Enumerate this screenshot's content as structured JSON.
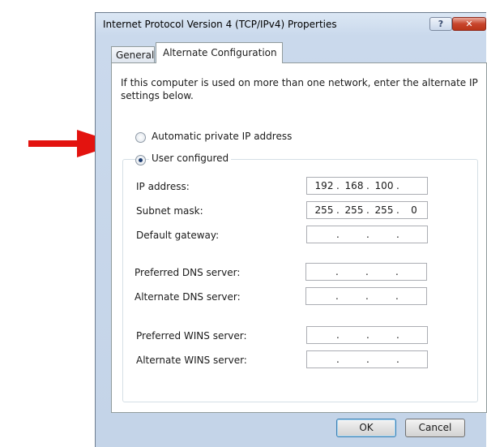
{
  "window": {
    "title": "Internet Protocol Version 4 (TCP/IPv4) Properties",
    "help_label": "?",
    "close_label": "✕"
  },
  "tabs": [
    {
      "label": "General"
    },
    {
      "label": "Alternate Configuration",
      "active": true
    }
  ],
  "description": "If this computer is used on more than one network, enter the alternate IP settings below.",
  "options": {
    "automatic": {
      "label": "Automatic private IP address",
      "checked": false
    },
    "user": {
      "label": "User configured",
      "checked": true
    }
  },
  "fields": [
    {
      "label": "IP address:",
      "octets": [
        "192",
        "168",
        "100",
        ""
      ]
    },
    {
      "label": "Subnet mask:",
      "octets": [
        "255",
        "255",
        "255",
        "0"
      ]
    },
    {
      "label": "Default gateway:",
      "octets": [
        "",
        "",
        "",
        ""
      ]
    },
    {
      "label": "Preferred DNS server:",
      "octets": [
        "",
        "",
        "",
        ""
      ]
    },
    {
      "label": "Alternate DNS server:",
      "octets": [
        "",
        "",
        "",
        ""
      ]
    },
    {
      "label": "Preferred WINS server:",
      "octets": [
        "",
        "",
        "",
        ""
      ]
    },
    {
      "label": "Alternate WINS server:",
      "octets": [
        "",
        "",
        "",
        ""
      ]
    }
  ],
  "buttons": {
    "ok": "OK",
    "cancel": "Cancel"
  },
  "colors": {
    "arrow": "#e3130f"
  }
}
